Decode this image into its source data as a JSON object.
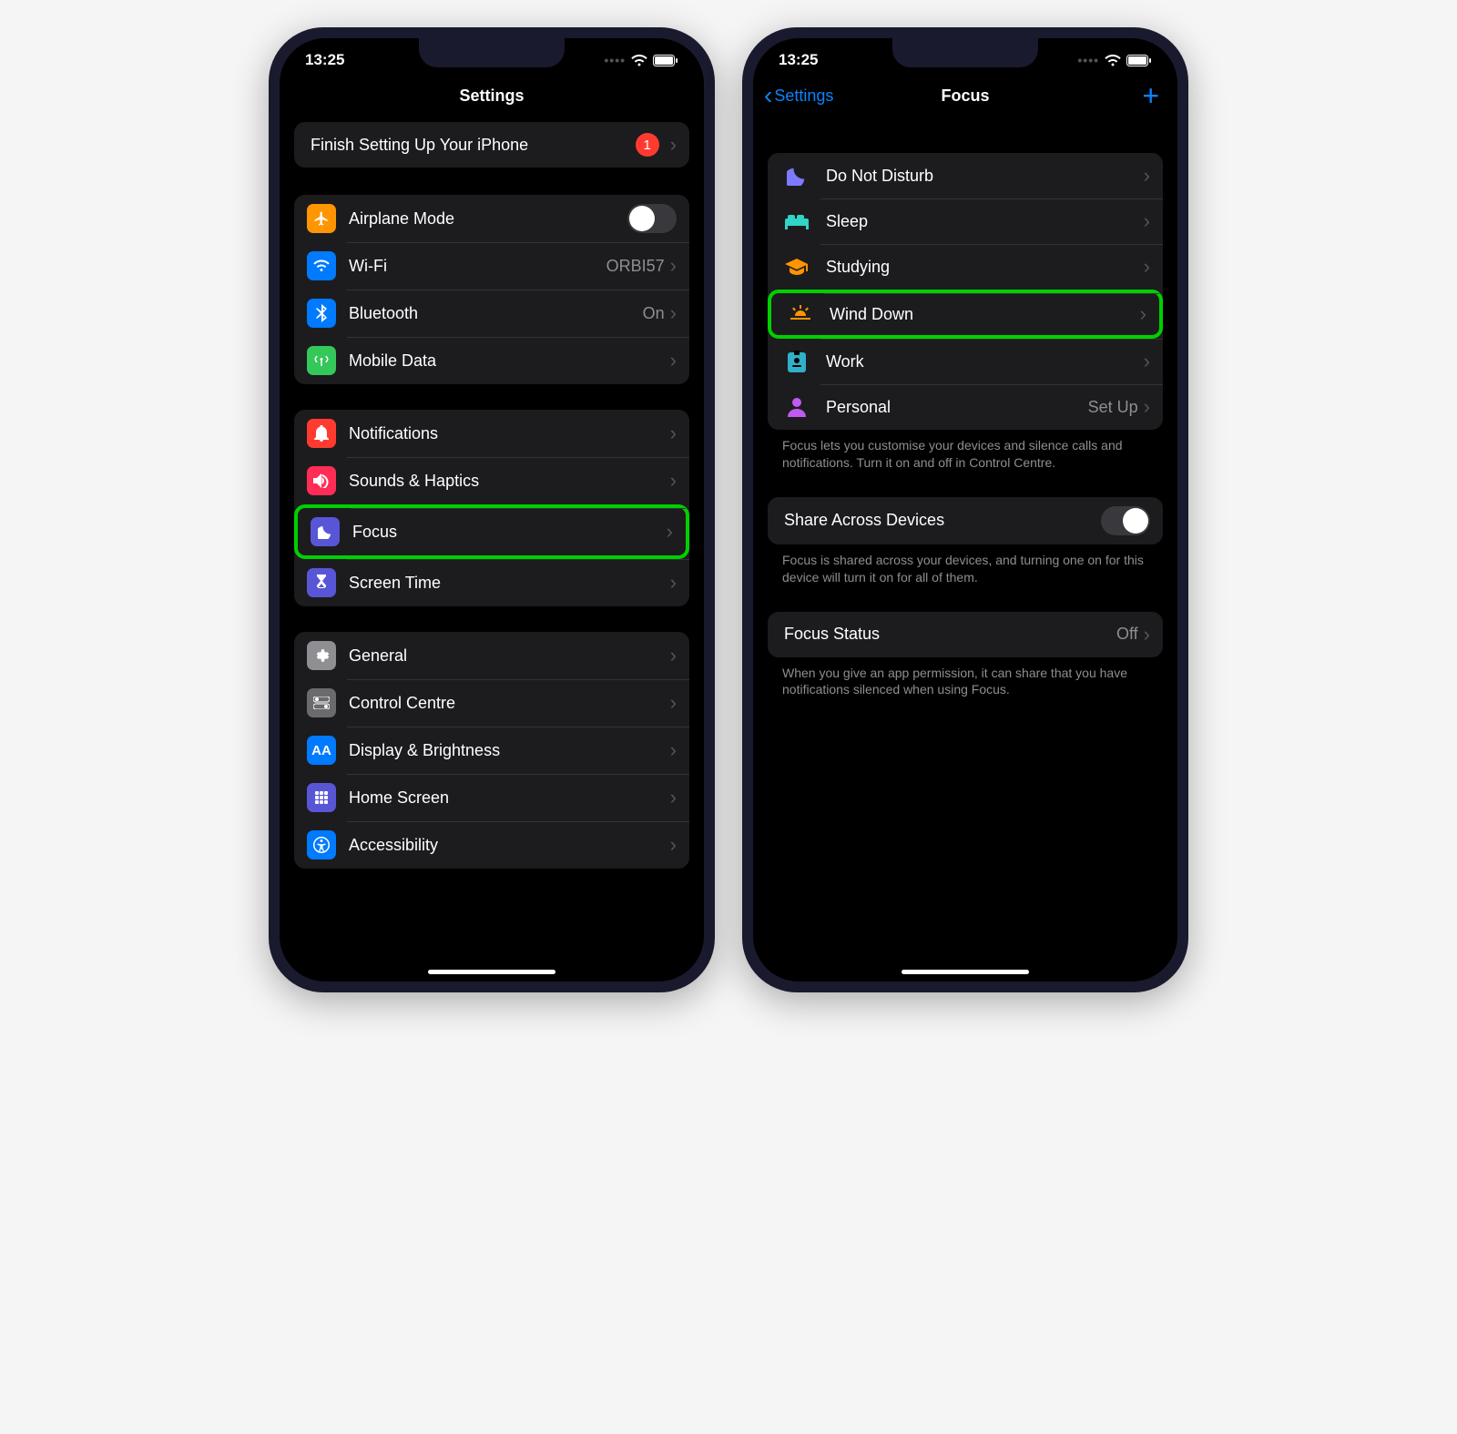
{
  "status": {
    "time": "13:25"
  },
  "left": {
    "title": "Settings",
    "banner": {
      "label": "Finish Setting Up Your iPhone",
      "badge": "1"
    },
    "connectivity": {
      "airplane": "Airplane Mode",
      "wifi": {
        "label": "Wi-Fi",
        "value": "ORBI57"
      },
      "bluetooth": {
        "label": "Bluetooth",
        "value": "On"
      },
      "mobile": "Mobile Data"
    },
    "focus_group": {
      "notifications": "Notifications",
      "sounds": "Sounds & Haptics",
      "focus": "Focus",
      "screentime": "Screen Time"
    },
    "general_group": {
      "general": "General",
      "control": "Control Centre",
      "display": "Display & Brightness",
      "home": "Home Screen",
      "accessibility": "Accessibility"
    }
  },
  "right": {
    "back": "Settings",
    "title": "Focus",
    "modes": {
      "dnd": "Do Not Disturb",
      "sleep": "Sleep",
      "studying": "Studying",
      "winddown": "Wind Down",
      "work": "Work",
      "personal": {
        "label": "Personal",
        "value": "Set Up"
      }
    },
    "footer1": "Focus lets you customise your devices and silence calls and notifications. Turn it on and off in Control Centre.",
    "share": "Share Across Devices",
    "footer2": "Focus is shared across your devices, and turning one on for this device will turn it on for all of them.",
    "status_row": {
      "label": "Focus Status",
      "value": "Off"
    },
    "footer3": "When you give an app permission, it can share that you have notifications silenced when using Focus."
  }
}
